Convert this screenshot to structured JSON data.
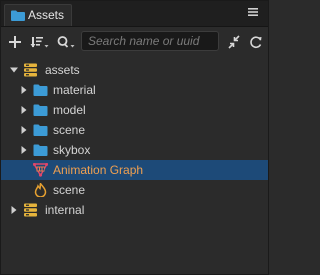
{
  "panel": {
    "tab_label": "Assets",
    "tab_icon": "folder-icon",
    "menu_icon": "menu-icon"
  },
  "toolbar": {
    "add_icon": "plus-icon",
    "sort_icon": "sort-icon",
    "filter_icon": "search-filter-icon",
    "search_placeholder": "Search name or uuid",
    "search_value": "",
    "collapse_icon": "collapse-icon",
    "refresh_icon": "refresh-icon"
  },
  "tree": {
    "rows": [
      {
        "label": "assets",
        "icon": "database-icon",
        "expanded": true,
        "level": 0
      },
      {
        "label": "material",
        "icon": "folder-icon",
        "expanded": false,
        "level": 1
      },
      {
        "label": "model",
        "icon": "folder-icon",
        "expanded": false,
        "level": 1
      },
      {
        "label": "scene",
        "icon": "folder-icon",
        "expanded": false,
        "level": 1
      },
      {
        "label": "skybox",
        "icon": "folder-icon",
        "expanded": false,
        "level": 1
      },
      {
        "label": "Animation Graph",
        "icon": "animation-graph-icon",
        "selected": true,
        "level": 1
      },
      {
        "label": "scene",
        "icon": "scene-icon",
        "level": 1
      },
      {
        "label": "internal",
        "icon": "database-icon",
        "expanded": false,
        "level": 0
      }
    ]
  },
  "colors": {
    "background": "#2b2b2b",
    "selection": "#1d4a78",
    "folder": "#3c9bd6",
    "database": "#e6b43c",
    "selected_text": "#f0a050"
  }
}
